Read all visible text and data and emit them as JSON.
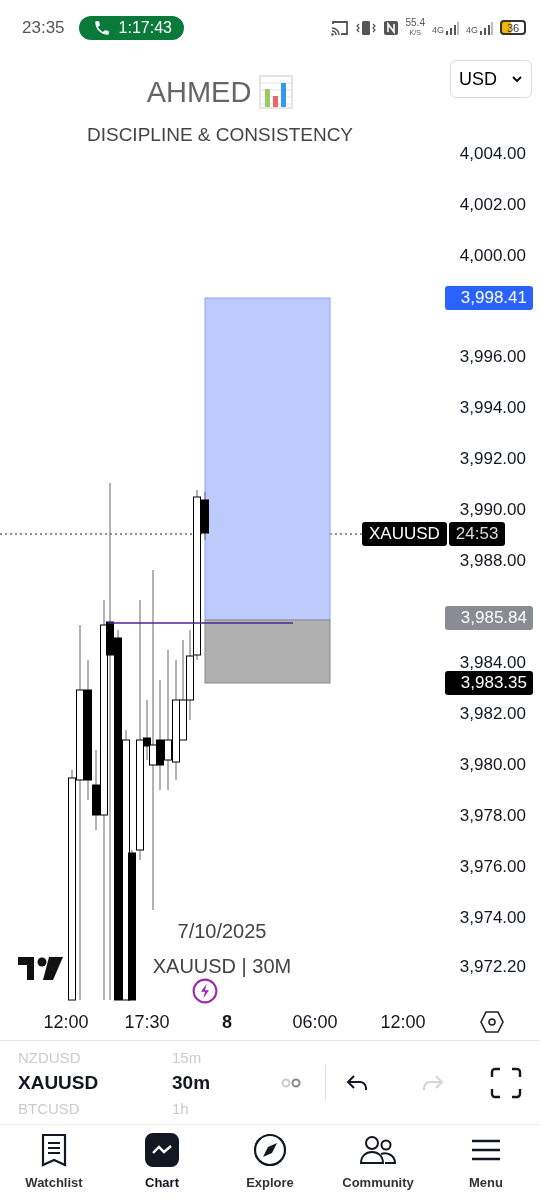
{
  "status_bar": {
    "time": "23:35",
    "call_timer": "1:17:43",
    "net_speed": "55.4",
    "net_unit": "K/S",
    "networks": [
      "4G",
      "4G"
    ],
    "battery": "36"
  },
  "header": {
    "title": "AHMED",
    "subtitle": "DISCIPLINE & CONSISTENCY",
    "currency": "USD"
  },
  "price_axis": [
    "4,004.00",
    "4,002.00",
    "4,000.00",
    "3,996.00",
    "3,994.00",
    "3,992.00",
    "3,990.00",
    "3,988.00",
    "3,984.00",
    "3,982.00",
    "3,980.00",
    "3,978.00",
    "3,976.00",
    "3,974.00",
    "3,972.20"
  ],
  "price_badges": [
    {
      "kind": "target",
      "text": "3,998.41"
    },
    {
      "kind": "entry",
      "text": "3,985.84"
    },
    {
      "kind": "stop",
      "text": "3,983.35"
    }
  ],
  "symbol_badge": {
    "symbol": "XAUUSD",
    "countdown": "24:53"
  },
  "chart_watermark": {
    "date": "7/10/2025",
    "caption": "XAUUSD | 30M"
  },
  "time_axis": [
    {
      "label": "12:00",
      "kind": "time"
    },
    {
      "label": "17:30",
      "kind": "time"
    },
    {
      "label": "8",
      "kind": "day"
    },
    {
      "label": "06:00",
      "kind": "time"
    },
    {
      "label": "12:00",
      "kind": "time"
    }
  ],
  "symbol_picker": [
    {
      "symbol": "NZDUSD",
      "interval": "15m",
      "selected": false
    },
    {
      "symbol": "XAUUSD",
      "interval": "30m",
      "selected": true
    },
    {
      "symbol": "BTCUSD",
      "interval": "1h",
      "selected": false
    }
  ],
  "toolbar": {
    "undo": {
      "disabled": false
    },
    "redo": {
      "disabled": true
    }
  },
  "nav": [
    {
      "label": "Watchlist",
      "selected": false
    },
    {
      "label": "Chart",
      "selected": true
    },
    {
      "label": "Explore",
      "selected": false
    },
    {
      "label": "Community",
      "selected": false
    },
    {
      "label": "Menu",
      "selected": false
    }
  ]
}
